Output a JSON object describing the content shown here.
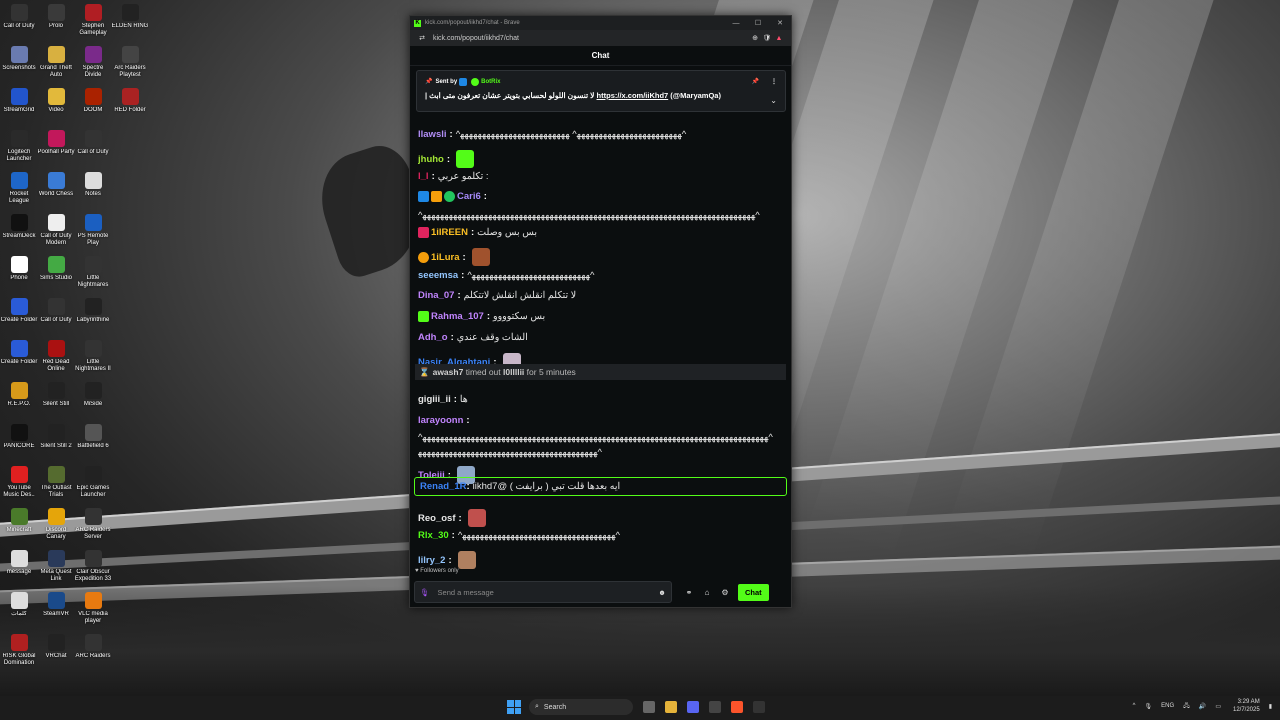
{
  "desktop": {
    "icons": [
      {
        "label": "Call of Duty",
        "color": "#333333"
      },
      {
        "label": "Prolo",
        "color": "#3a3a3a"
      },
      {
        "label": "Stephen Gameplay",
        "color": "#b01e23"
      },
      {
        "label": "ELDEN RING",
        "color": "#222222"
      },
      {
        "label": "Screenshots",
        "color": "#6a7bb0"
      },
      {
        "label": "Grand Theft Auto",
        "color": "#d8b040"
      },
      {
        "label": "Spectre Divide",
        "color": "#7a2a8a"
      },
      {
        "label": "Arc Raiders Playtest",
        "color": "#444444"
      },
      {
        "label": "StreamGrid",
        "color": "#2255cc"
      },
      {
        "label": "Video",
        "color": "#e2b93b"
      },
      {
        "label": "DOOM",
        "color": "#aa2200"
      },
      {
        "label": "RED Folder",
        "color": "#aa2222"
      },
      {
        "label": "Logitech Launcher",
        "color": "#2a2a2a"
      },
      {
        "label": "Poolhall Party",
        "color": "#c2185b"
      },
      {
        "label": "Call of Duty",
        "color": "#333333"
      },
      {
        "label": "Rocket League",
        "color": "#1e66c8"
      },
      {
        "label": "World Chess",
        "color": "#3a7bd5"
      },
      {
        "label": "Notes",
        "color": "#dddddd"
      },
      {
        "label": "StreamDeck",
        "color": "#111111"
      },
      {
        "label": "Call of Duty Modern",
        "color": "#eeeeee"
      },
      {
        "label": "PS Remote Play",
        "color": "#1b5fc1"
      },
      {
        "label": "Phone",
        "color": "#ffffff"
      },
      {
        "label": "Sims Studio",
        "color": "#44aa44"
      },
      {
        "label": "Little Nightmares",
        "color": "#333333"
      },
      {
        "label": "Create Folder",
        "color": "#2a5bd7"
      },
      {
        "label": "Call of Duty",
        "color": "#333333"
      },
      {
        "label": "Labyrinthine",
        "color": "#222222"
      },
      {
        "label": "Create Folder",
        "color": "#2a5bd7"
      },
      {
        "label": "Red Dead Online",
        "color": "#aa1111"
      },
      {
        "label": "Little Nightmares II",
        "color": "#333333"
      },
      {
        "label": "R.E.P.O.",
        "color": "#d79a1a"
      },
      {
        "label": "Silent Still",
        "color": "#222222"
      },
      {
        "label": "MiSide",
        "color": "#222222"
      },
      {
        "label": "PANICORE",
        "color": "#111111"
      },
      {
        "label": "Silent Still 2",
        "color": "#222222"
      },
      {
        "label": "Battlefield 6",
        "color": "#555555"
      },
      {
        "label": "YouTube Music Des..",
        "color": "#e02020"
      },
      {
        "label": "The Outlast Trials",
        "color": "#556b2f"
      },
      {
        "label": "Epic Games Launcher",
        "color": "#222222"
      },
      {
        "label": "Minecraft",
        "color": "#4a7a2a"
      },
      {
        "label": "Discord Canary",
        "color": "#e5a50a"
      },
      {
        "label": "ARC Raiders Server",
        "color": "#333333"
      },
      {
        "label": "message",
        "color": "#dddddd"
      },
      {
        "label": "Meta Quest Link",
        "color": "#2a3a5a"
      },
      {
        "label": "Clair Obscur Expedition 33",
        "color": "#333333"
      },
      {
        "label": "كلمات",
        "color": "#dddddd"
      },
      {
        "label": "SteamVR",
        "color": "#1a4a8a"
      },
      {
        "label": "VLC media player",
        "color": "#e87a10"
      },
      {
        "label": "RISK Global Domination",
        "color": "#b02020"
      },
      {
        "label": "VRChat",
        "color": "#222222"
      },
      {
        "label": "ARC Raiders",
        "color": "#333333"
      }
    ]
  },
  "browser": {
    "title": "kick.com/popout/iikhd7/chat - Brave",
    "url": "kick.com/popout/iikhd7/chat",
    "controls": {
      "minimize": "—",
      "maximize": "☐",
      "close": "✕"
    },
    "zoom_icon": "⊕",
    "shield_icon": "🛡",
    "rewards_icon": "▲"
  },
  "chat": {
    "header": "Chat",
    "pinned": {
      "sent_by_label": "Sent by",
      "sender": "BotRix",
      "message_ar": "لا تنسون اللولو لحسابي بتويتر عشان تعرفون متى ابث |",
      "link": "https://x.com/iiKhd7",
      "handle": "(@MaryamQa)",
      "pin_icon": "📌",
      "more_icon": "⋮",
      "chevron": "⌄"
    },
    "messages": [
      {
        "user": "llawsli",
        "color": "#b28ef7",
        "text": "^ﻬﻬﻬﻬﻬﻬﻬﻬﻬﻬﻬﻬﻬﻬﻬﻬﻬﻬﻬﻬﻬﻬﻬﻬ^ ﻬﻬﻬﻬﻬﻬﻬﻬﻬﻬﻬﻬﻬﻬﻬﻬﻬﻬﻬﻬﻬﻬﻬﻬﻬ^"
      },
      {
        "user": "jhuho",
        "color": "#a3e635",
        "text": ""
      },
      {
        "user": "l_l",
        "color": "#e0245e",
        "text": ": تكلمو عربي"
      },
      {
        "user": "Cari6",
        "color": "#a78bfa",
        "text": ""
      },
      {
        "user": "",
        "color": "#e6e6e6",
        "text": "^ﻬﻬﻬﻬﻬﻬﻬﻬﻬﻬﻬﻬﻬﻬﻬﻬﻬﻬﻬﻬﻬﻬﻬﻬﻬﻬﻬﻬﻬﻬﻬﻬﻬﻬﻬﻬﻬﻬﻬﻬﻬﻬﻬﻬﻬﻬﻬﻬﻬﻬﻬﻬﻬﻬﻬﻬﻬﻬﻬﻬﻬﻬﻬﻬﻬﻬﻬﻬﻬﻬﻬﻬﻬﻬﻬﻬ^"
      },
      {
        "user": "1iIREEN",
        "color": "#fbbf24",
        "text": "بس بس وصلت"
      },
      {
        "user": "1iLura",
        "color": "#fbbf24",
        "text": ""
      },
      {
        "user": "seeemsa",
        "color": "#93c5fd",
        "text": "^ﻬﻬﻬﻬﻬﻬﻬﻬﻬﻬﻬﻬﻬﻬﻬﻬﻬﻬﻬﻬﻬﻬﻬﻬﻬﻬﻬ^"
      },
      {
        "user": "Dina_07",
        "color": "#c084fc",
        "text": "لا تتكلم انقلش انقلش لاتتكلم"
      },
      {
        "user": "Rahma_107",
        "color": "#c084fc",
        "text": "بس سكتوووو"
      },
      {
        "user": "Adh_o",
        "color": "#c084fc",
        "text": "الشات وقف عندي"
      },
      {
        "user": "Nasir_Alqahtani",
        "color": "#3b82f6",
        "text": ""
      },
      {
        "user": "gigiii_ii",
        "color": "#e6e6e6",
        "text": "ها"
      },
      {
        "user": "larayoonn",
        "color": "#c084fc",
        "text": ""
      },
      {
        "user": "",
        "color": "#e6e6e6",
        "text": "^ﻬﻬﻬﻬﻬﻬﻬﻬﻬﻬﻬﻬﻬﻬﻬﻬﻬﻬﻬﻬﻬﻬﻬﻬﻬﻬﻬﻬﻬﻬﻬﻬﻬﻬﻬﻬﻬﻬﻬﻬﻬﻬﻬﻬﻬﻬﻬﻬﻬﻬﻬﻬﻬﻬﻬﻬﻬﻬﻬﻬﻬﻬﻬﻬﻬﻬﻬﻬﻬﻬﻬﻬﻬﻬﻬﻬﻬﻬﻬ^"
      },
      {
        "user": "",
        "color": "#e6e6e6",
        "text": "^ﻬﻬﻬﻬﻬﻬﻬﻬﻬﻬﻬﻬﻬﻬﻬﻬﻬﻬﻬﻬﻬﻬﻬﻬﻬﻬﻬﻬﻬﻬﻬﻬﻬﻬﻬﻬﻬﻬﻬﻬﻬ"
      },
      {
        "user": "Toleiii",
        "color": "#c084fc",
        "text": ""
      },
      {
        "user": "Reo_osf",
        "color": "#e6e6e6",
        "text": ""
      },
      {
        "user": "Rlx_30",
        "color": "#53fc18",
        "text": "^ﻬﻬﻬﻬﻬﻬﻬﻬﻬﻬﻬﻬﻬﻬﻬﻬﻬﻬﻬﻬﻬﻬﻬﻬﻬﻬﻬﻬﻬﻬﻬﻬﻬﻬﻬ^"
      },
      {
        "user": "lilry_2",
        "color": "#93c5fd",
        "text": ""
      }
    ],
    "timeout": {
      "user": "awash7",
      "action": "timed out",
      "target": "l0llllii",
      "duration": "for 5 minutes"
    },
    "highlight": {
      "user": "Renad_1R",
      "color": "#3b82f6",
      "text": "ايه بعدها قلت تبي ( برايفت ) @iikhd7"
    },
    "followers_only": "Followers only",
    "input_placeholder": "Send a message",
    "send_label": "Chat"
  },
  "taskbar": {
    "search_label": "Search",
    "lang": "ENG",
    "time": "3:29 AM",
    "date": "12/7/2025"
  }
}
